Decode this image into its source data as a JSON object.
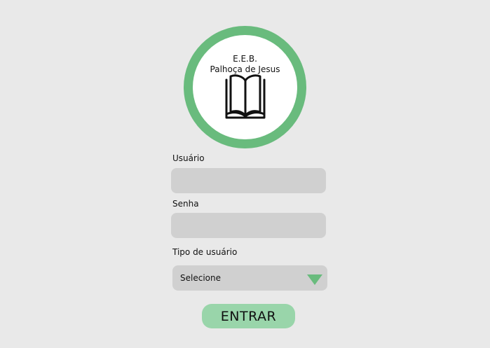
{
  "logo": {
    "line1": "E.E.B.",
    "line2": "Palhoça de Jesus",
    "icon": "open-book-icon"
  },
  "form": {
    "user_label": "Usuário",
    "user_value": "",
    "password_label": "Senha",
    "password_value": "",
    "user_type_label": "Tipo de usuário",
    "user_type_selected": "Selecione",
    "submit_label": "ENTRAR"
  },
  "colors": {
    "background": "#e9e9e9",
    "accent": "#69bb7d",
    "button": "#99d5aa",
    "field": "#d0d0d0"
  }
}
